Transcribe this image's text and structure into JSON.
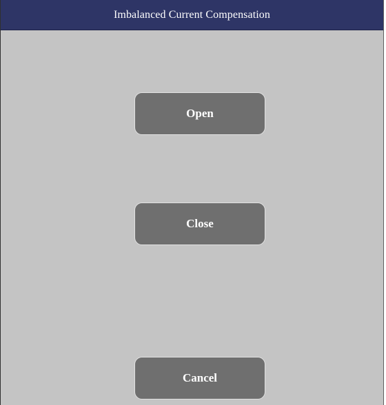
{
  "window": {
    "title": "Imbalanced Current Compensation"
  },
  "buttons": {
    "open_label": "Open",
    "close_label": "Close",
    "cancel_label": "Cancel"
  },
  "colors": {
    "titlebar_bg": "#2e3566",
    "dialog_bg": "#c4c4c4",
    "button_bg": "#6f6f6f",
    "button_text": "#ffffff"
  }
}
